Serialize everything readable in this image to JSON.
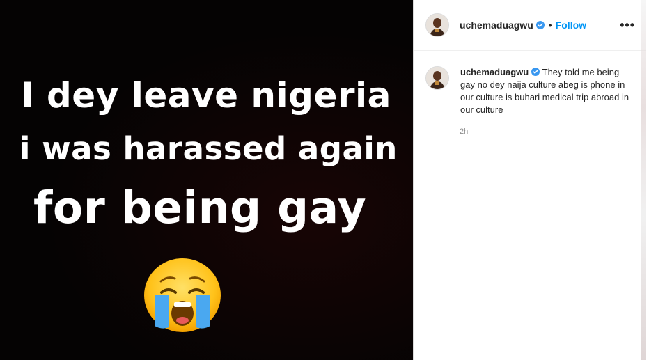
{
  "post": {
    "image_text": {
      "line1": "I dey leave nigeria",
      "line2": "i was harassed again",
      "line3": "for being gay"
    },
    "emoji": "loudly-crying-face"
  },
  "header": {
    "username": "uchemaduagwu",
    "separator": "•",
    "follow_label": "Follow",
    "more_label": "•••"
  },
  "caption": {
    "username": "uchemaduagwu",
    "text": "They told me being gay no dey naija culture abeg is phone in our culture is buhari medical trip abroad in our culture",
    "time": "2h"
  },
  "colors": {
    "accent": "#0095f6",
    "verified": "#3897f0",
    "media_bg": "#050303"
  }
}
